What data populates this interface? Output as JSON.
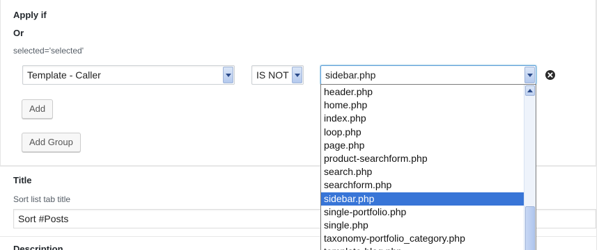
{
  "apply_if_label": "Apply if",
  "or_label": "Or",
  "selected_attr_text": "selected='selected'",
  "condition": {
    "caller_select_value": "Template - Caller",
    "operator_select_value": "IS NOT",
    "template_select_value": "sidebar.php",
    "template_options": [
      "header.php",
      "home.php",
      "index.php",
      "loop.php",
      "page.php",
      "product-searchform.php",
      "search.php",
      "searchform.php",
      "sidebar.php",
      "single-portfolio.php",
      "single.php",
      "taxonomy-portfolio_category.php",
      "template-blog.php"
    ],
    "highlighted_option": "sidebar.php"
  },
  "buttons": {
    "add_label": "Add",
    "add_group_label": "Add Group"
  },
  "title_section": {
    "heading": "Title",
    "description": "Sort list tab title",
    "input_value": "Sort #Posts"
  },
  "next_section_partial_heading": "Description",
  "icons": {
    "remove": "remove-circle-icon",
    "select_arrow": "chevron-down-icon",
    "scroll_up": "chevron-up-icon"
  },
  "colors": {
    "highlight": "#3875d7",
    "focus_border": "#5b9dd9"
  }
}
